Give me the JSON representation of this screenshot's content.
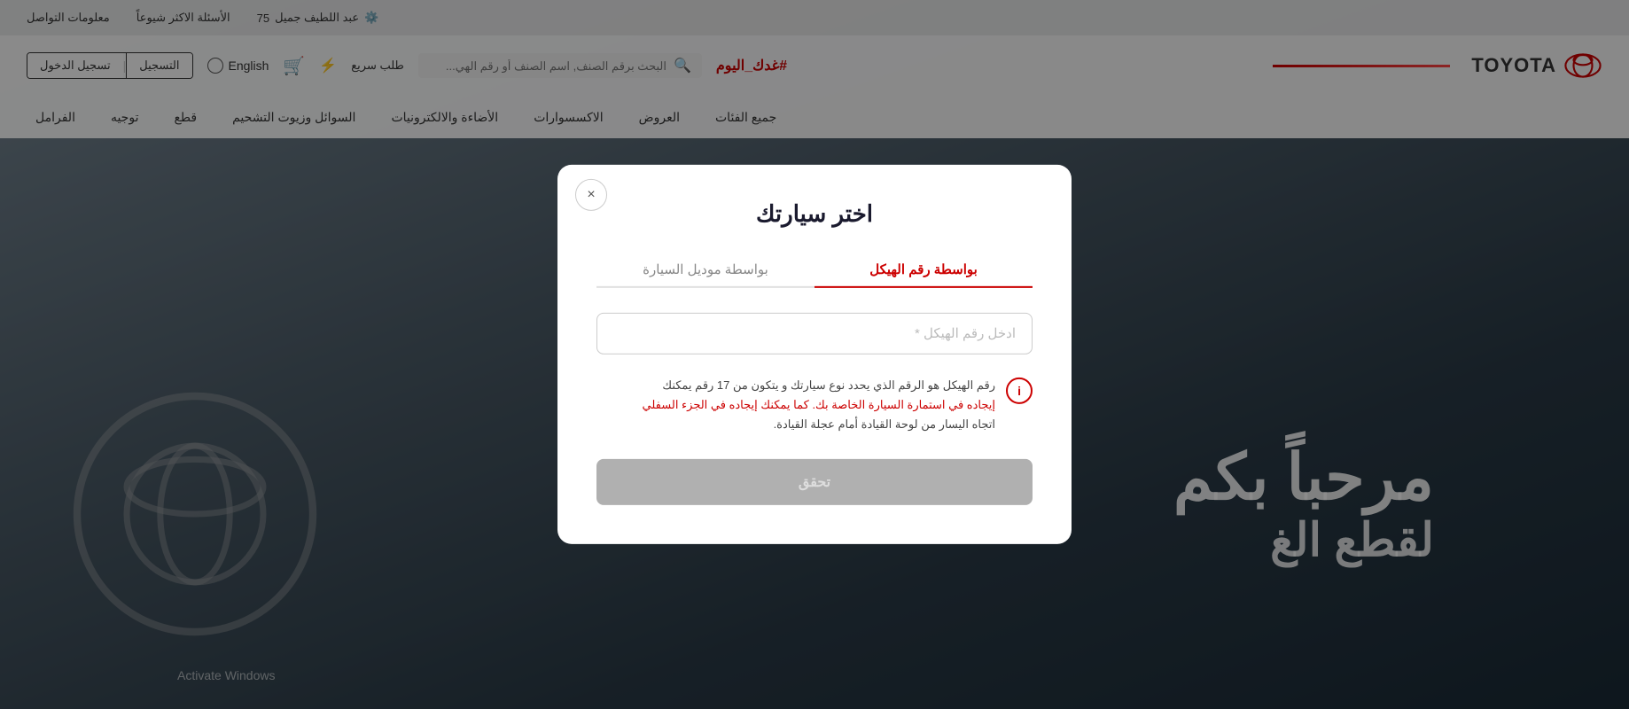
{
  "topbar": {
    "brand_name": "عبد اللطيف جميل",
    "brand_years": "75",
    "faq_label": "الأسئلة الاكثر شيوعاً",
    "contact_label": "معلومات التواصل"
  },
  "header": {
    "logo_text": "TOYOTA",
    "hashtag": "#غدك_اليوم",
    "login_label": "تسجيل الدخول",
    "register_label": "التسجيل",
    "language_label": "English",
    "quick_order_label": "طلب سريع",
    "search_placeholder": "البحث برقم الصنف, اسم الصنف أو رقم الهي..."
  },
  "nav": {
    "items": [
      {
        "label": "جميع الفئات"
      },
      {
        "label": "العروض"
      },
      {
        "label": "الاكسسوارات"
      },
      {
        "label": "الأضاءة والالكترونيات"
      },
      {
        "label": "السوائل وزيوت التشحيم"
      },
      {
        "label": "قطع"
      },
      {
        "label": "توجيه"
      },
      {
        "label": "الفرامل"
      }
    ]
  },
  "modal": {
    "title": "اختر سيارتك",
    "close_icon": "×",
    "tab_vin": {
      "label": "بواسطة رقم الهيكل",
      "active": true
    },
    "tab_model": {
      "label": "بواسطة موديل السيارة",
      "active": false
    },
    "vin_input_placeholder": "ادخل رقم الهيكل *",
    "info_text_line1": "رقم الهيكل هو الرقم الذي يحدد نوع سيارتك و يتكون من 17 رقم يمكنك",
    "info_text_line2": "إيجاده في استمارة السيارة الخاصة بك. كما يمكنك إيجاده في الجزء السفلي",
    "info_text_line3": "اتجاه اليسار من لوحة القيادة أمام عجلة القيادة.",
    "submit_label": "تحقق"
  },
  "activate_windows": "Activate Windows"
}
